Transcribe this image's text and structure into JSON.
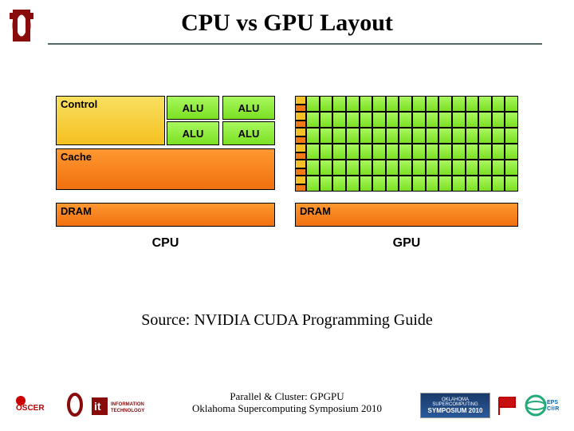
{
  "title": "CPU vs GPU Layout",
  "cpu": {
    "control": "Control",
    "alu": "ALU",
    "cache": "Cache",
    "dram": "DRAM",
    "label": "CPU"
  },
  "gpu": {
    "dram": "DRAM",
    "label": "GPU",
    "rows": 6,
    "alus_per_row": 16
  },
  "source": "Source: NVIDIA CUDA Programming Guide",
  "footer": {
    "line1": "Parallel & Cluster: GPGPU",
    "line2": "Oklahoma Supercomputing Symposium 2010"
  },
  "colors": {
    "control": "#f5c028",
    "alu": "#7be022",
    "cache": "#f07a18",
    "dram": "#f07a18"
  }
}
